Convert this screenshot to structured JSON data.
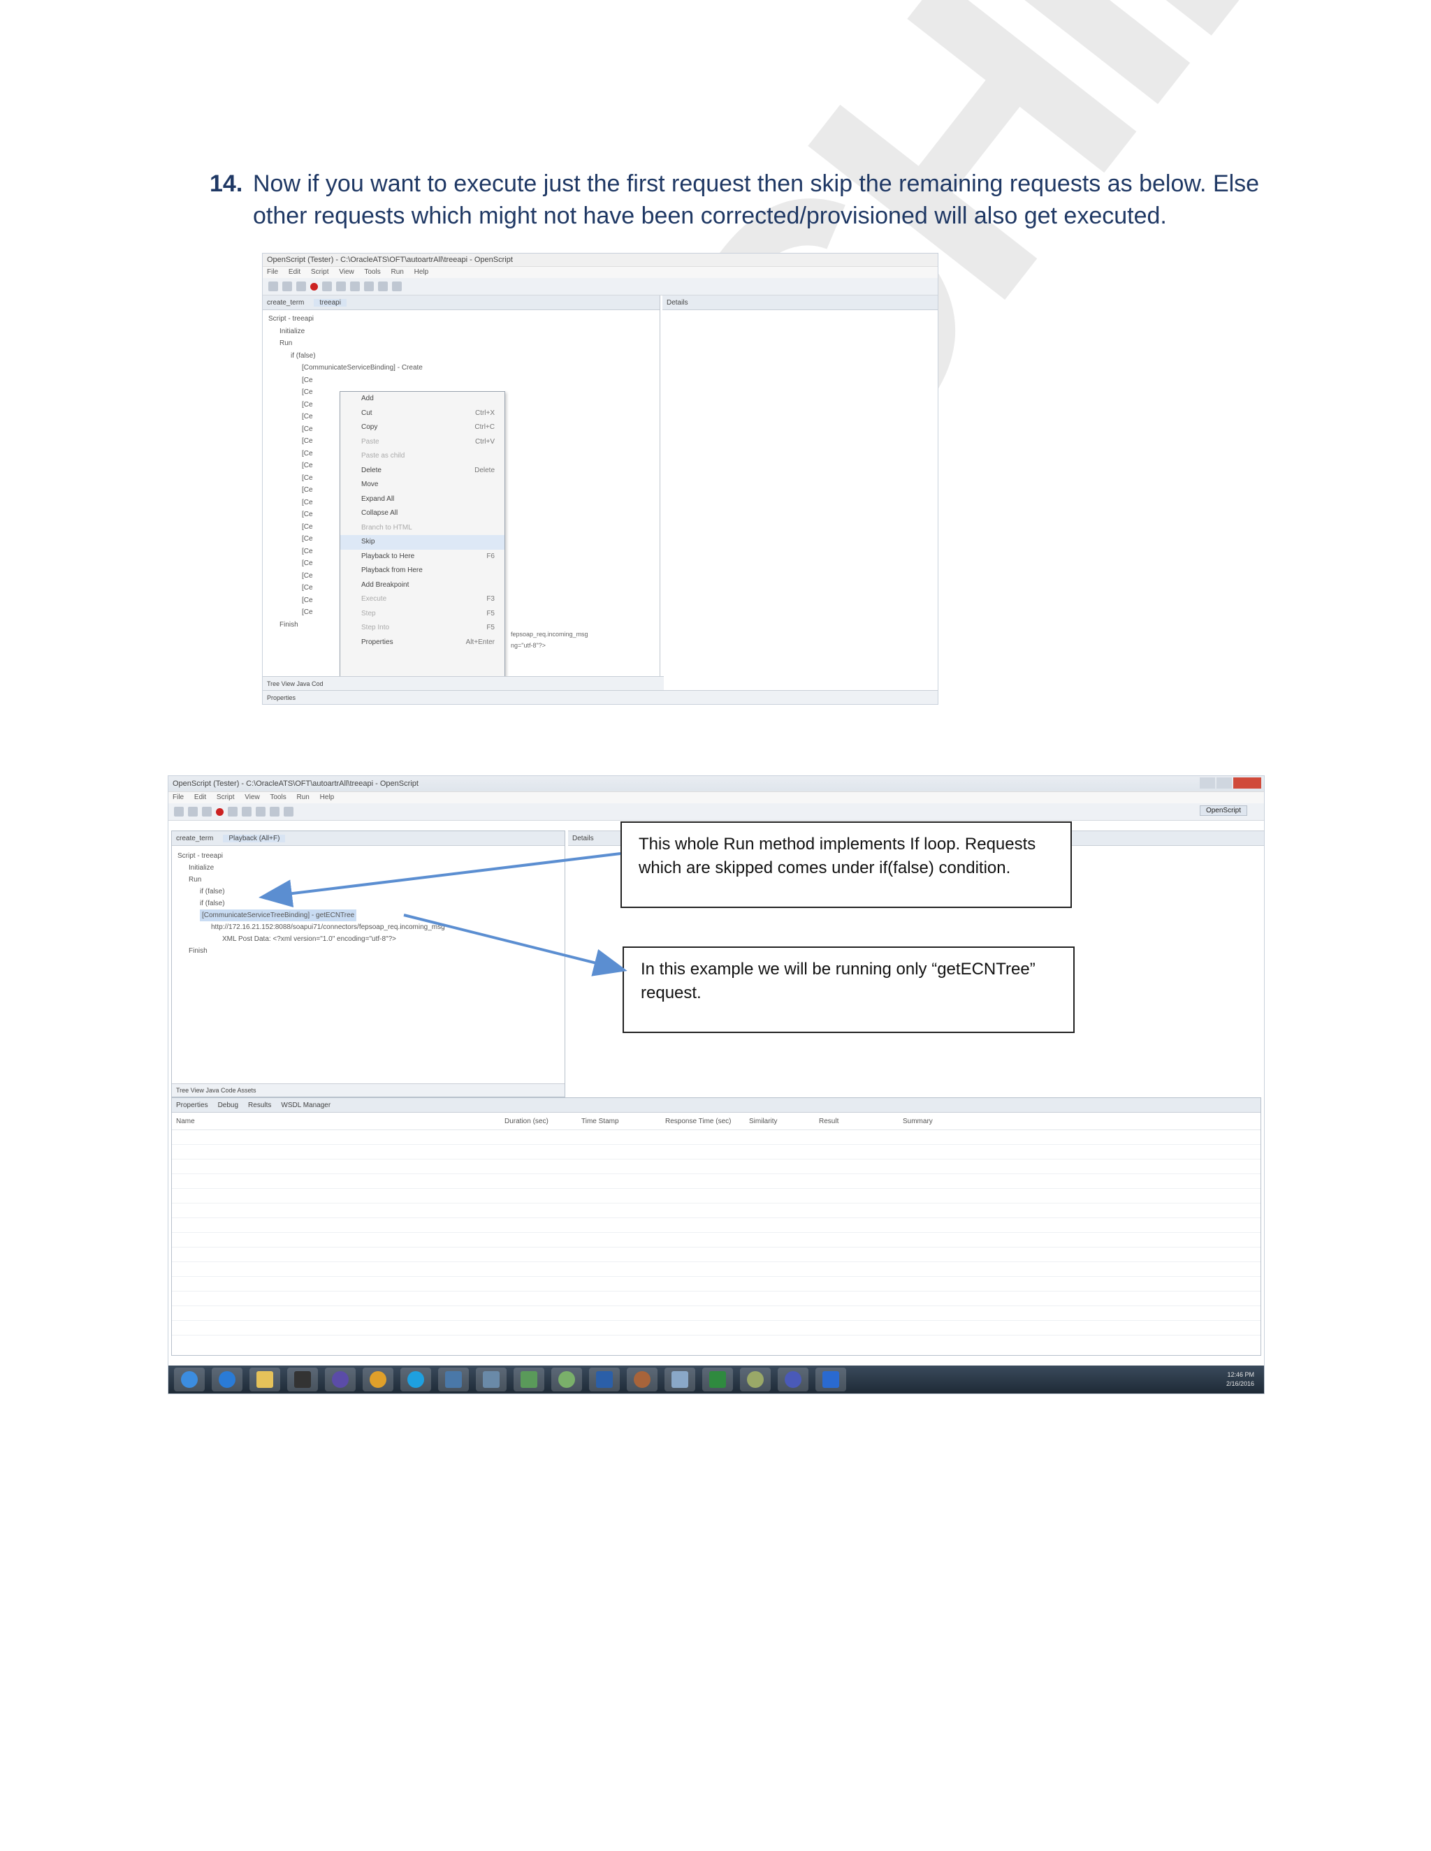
{
  "step": {
    "number": "14.",
    "text": "Now if you want to execute just the first request then skip the remaining requests as below. Else other requests which might not have been corrected/provisioned will also get executed."
  },
  "watermark": "ECHIE",
  "screenshot1": {
    "title": "OpenScript (Tester) - C:\\OracleATS\\OFT\\autoartrAll\\treeapi - OpenScript",
    "menu": [
      "File",
      "Edit",
      "Script",
      "View",
      "Tools",
      "Run",
      "Help"
    ],
    "tabs": [
      "create_term",
      "treeapi"
    ],
    "details_tab": "Details",
    "tree": [
      "Script - treeapi",
      "Initialize",
      "Run",
      "if (false)",
      "[CommunicateServiceBinding] - Create",
      "[Ce",
      "[Ce",
      "[Ce",
      "[Ce",
      "[Ce",
      "[Ce",
      "[Ce",
      "[Ce",
      "[Ce",
      "[Ce",
      "[Ce",
      "[Ce",
      "[Ce",
      "[Ce",
      "[Ce",
      "[Ce",
      "[Ce",
      "[Ce",
      "[Ce",
      "[Ce",
      "Finish"
    ],
    "context_menu": [
      {
        "label": "Add",
        "shortcut": "",
        "disabled": false
      },
      {
        "label": "Cut",
        "shortcut": "Ctrl+X",
        "disabled": false
      },
      {
        "label": "Copy",
        "shortcut": "Ctrl+C",
        "disabled": false
      },
      {
        "label": "Paste",
        "shortcut": "Ctrl+V",
        "disabled": true
      },
      {
        "label": "Paste as child",
        "shortcut": "",
        "disabled": true
      },
      {
        "label": "Delete",
        "shortcut": "Delete",
        "disabled": false
      },
      {
        "label": "Move",
        "shortcut": "",
        "disabled": false
      },
      {
        "label": "Expand All",
        "shortcut": "",
        "disabled": false
      },
      {
        "label": "Collapse All",
        "shortcut": "",
        "disabled": false
      },
      {
        "label": "Branch to HTML",
        "shortcut": "",
        "disabled": true
      },
      {
        "label": "Skip",
        "shortcut": "",
        "disabled": false
      },
      {
        "label": "Playback to Here",
        "shortcut": "F6",
        "disabled": false
      },
      {
        "label": "Playback from Here",
        "shortcut": "",
        "disabled": false
      },
      {
        "label": "Add Breakpoint",
        "shortcut": "",
        "disabled": false
      },
      {
        "label": "Execute",
        "shortcut": "F3",
        "disabled": true
      },
      {
        "label": "Step",
        "shortcut": "F5",
        "disabled": true
      },
      {
        "label": "Step Into",
        "shortcut": "F5",
        "disabled": true
      },
      {
        "label": "Properties",
        "shortcut": "Alt+Enter",
        "disabled": false
      }
    ],
    "tree_right_text_1": "fepsoap_req.incoming_msg",
    "tree_right_text_2": "ng=\"utf-8\"?>",
    "bottom_tabs": "Tree View  Java Cod",
    "properties_tab": "Properties"
  },
  "screenshot2": {
    "title": "OpenScript (Tester) - C:\\OracleATS\\OFT\\autoartrAll\\treeapi - OpenScript",
    "menu": [
      "File",
      "Edit",
      "Script",
      "View",
      "Tools",
      "Run",
      "Help"
    ],
    "tabs": [
      "create_term",
      "Playback (All+F)"
    ],
    "perspective": "OpenScript",
    "details_tab": "Details",
    "tree": [
      {
        "label": "Script - treeapi",
        "indent": 0,
        "selected": false
      },
      {
        "label": "Initialize",
        "indent": 1,
        "selected": false
      },
      {
        "label": "Run",
        "indent": 1,
        "selected": false
      },
      {
        "label": "if (false)",
        "indent": 2,
        "selected": false
      },
      {
        "label": "if (false)",
        "indent": 2,
        "selected": false
      },
      {
        "label": "[CommunicateServiceTreeBinding] - getECNTree",
        "indent": 2,
        "selected": true
      },
      {
        "label": "http://172.16.21.152:8088/soapui71/connectors/fepsoap_req.incoming_msg",
        "indent": 3,
        "selected": false
      },
      {
        "label": "XML Post Data: <?xml version=\"1.0\" encoding=\"utf-8\"?>",
        "indent": 4,
        "selected": false
      },
      {
        "label": "Finish",
        "indent": 1,
        "selected": false
      }
    ],
    "bottom_tabs": "Tree View  Java Code  Assets",
    "result_tabs": [
      "Properties",
      "Debug",
      "Results",
      "WSDL Manager"
    ],
    "columns": [
      "Name",
      "Duration (sec)",
      "Time Stamp",
      "Response Time (sec)",
      "Similarity",
      "Result",
      "Summary"
    ],
    "tray_time": "12:46 PM",
    "tray_date": "2/16/2016"
  },
  "callouts": {
    "first": "This whole Run method implements If loop. Requests which are skipped comes under if(false) condition.",
    "second": "In this example we will be running only “getECNTree” request."
  }
}
